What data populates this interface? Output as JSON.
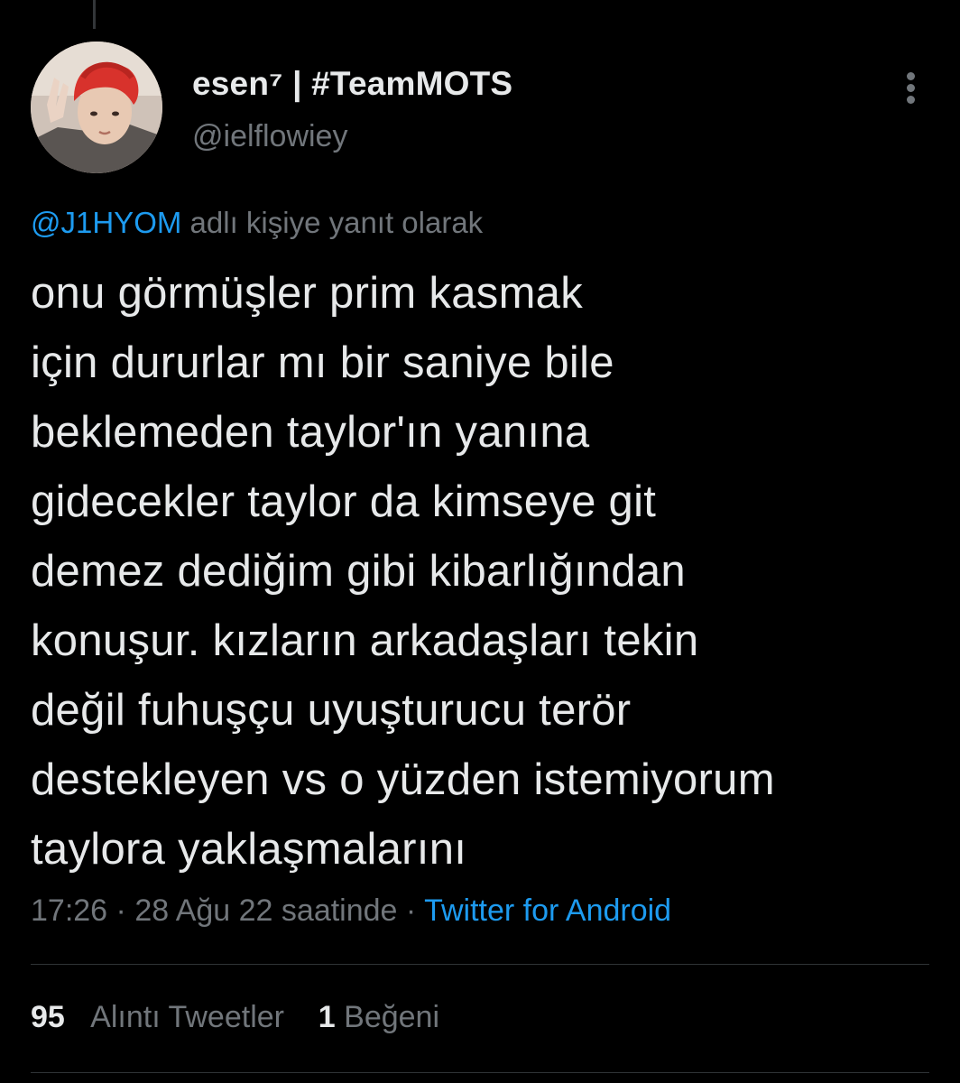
{
  "author": {
    "display_name": "esen⁷ | #TeamMOTS",
    "handle": "@ielflowiey",
    "avatar_icon": "user-avatar-photo"
  },
  "reply_context": {
    "mention": "@J1HYOM",
    "suffix": " adlı kişiye yanıt olarak"
  },
  "tweet": {
    "lines": [
      "onu görmüşler prim kasmak",
      "için dururlar mı bir saniye bile",
      "beklemeden taylor'ın yanına",
      "gidecekler taylor da kimseye git",
      "demez dediğim gibi kibarlığından",
      "konuşur. kızların arkadaşları tekin",
      "değil fuhuşçu uyuşturucu terör",
      "destekleyen vs o yüzden istemiyorum",
      "taylora yaklaşmalarını"
    ]
  },
  "meta": {
    "time": "17:26",
    "separator": " · ",
    "date": "28 Ağu 22 saatinde",
    "source": "Twitter for Android"
  },
  "stats": {
    "quote_count": "95",
    "quote_label": "Alıntı Tweetler",
    "like_count": "1",
    "like_label": "Beğeni"
  },
  "colors": {
    "background": "#000000",
    "primary_text": "#e7e9ea",
    "secondary_text": "#71767b",
    "link": "#1d9bf0",
    "divider": "#2f3336"
  },
  "icons": {
    "more": "more-vertical-icon"
  }
}
